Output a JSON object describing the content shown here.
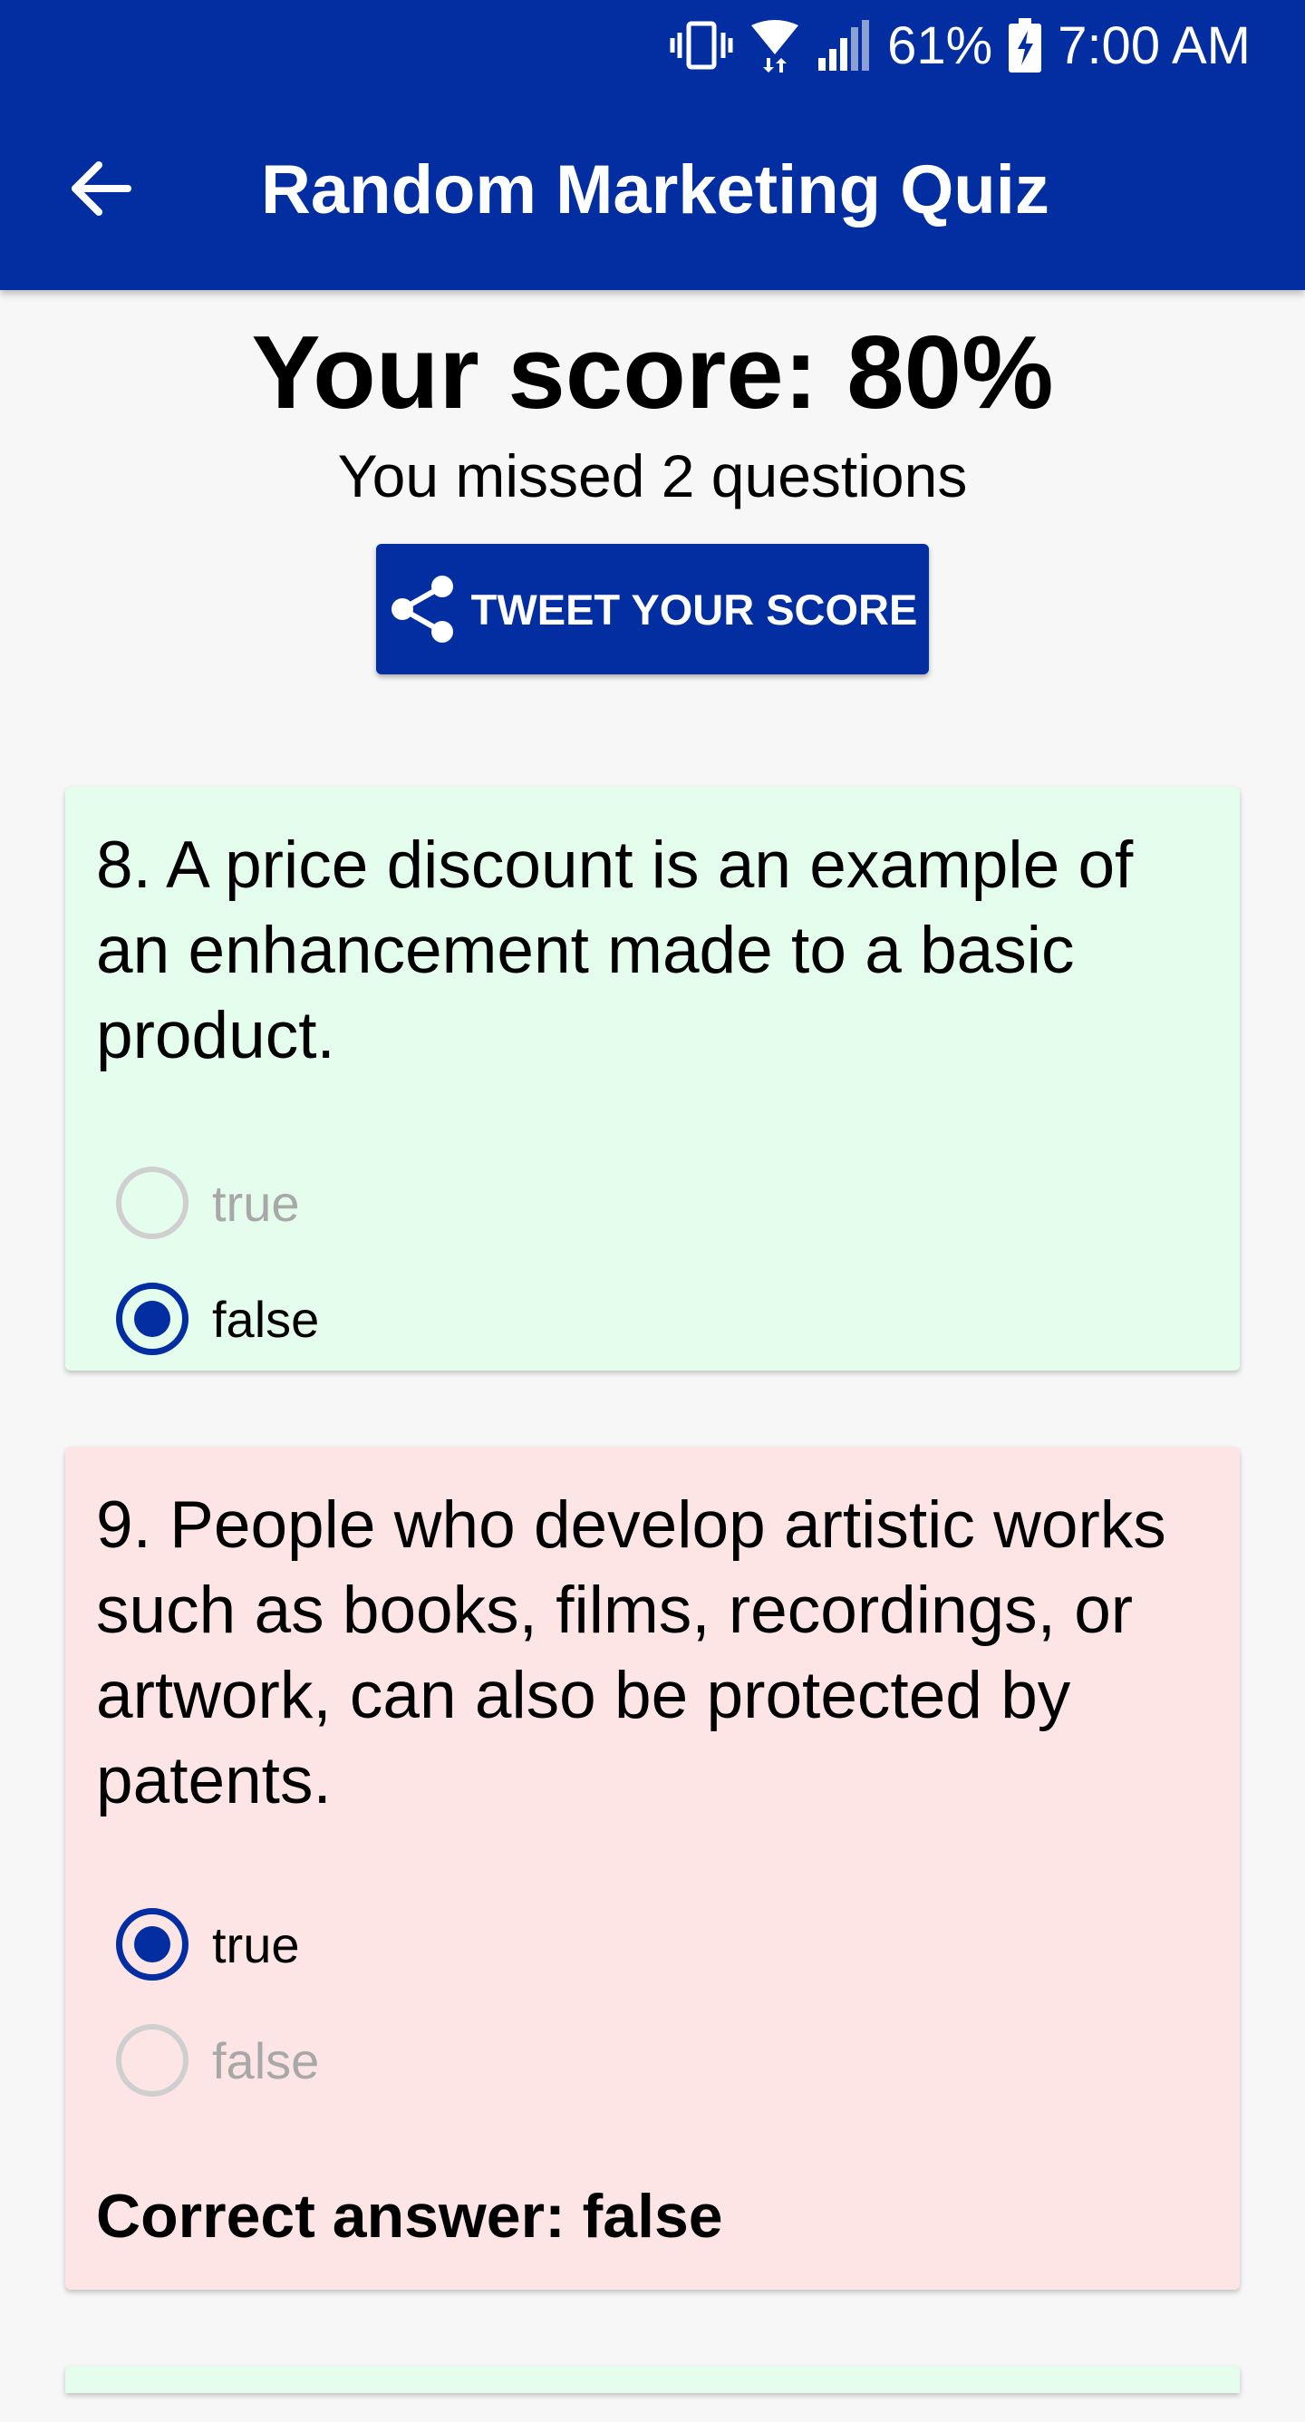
{
  "status_bar": {
    "battery": "61%",
    "time": "7:00 AM"
  },
  "app_bar": {
    "title": "Random Marketing Quiz"
  },
  "results": {
    "score": "Your score: 80%",
    "missed": "You missed 2 questions",
    "tweet_label": "TWEET YOUR SCORE"
  },
  "questions": [
    {
      "text": "8. A price discount is an example of an enhancement made to a basic product.",
      "status": "correct",
      "options": [
        {
          "label": "true",
          "selected": false
        },
        {
          "label": "false",
          "selected": true
        }
      ]
    },
    {
      "text": "9. People who develop artistic works such as books, films, recordings, or artwork, can also be protected by patents.",
      "status": "wrong",
      "options": [
        {
          "label": "true",
          "selected": true
        },
        {
          "label": "false",
          "selected": false
        }
      ],
      "correct_answer": "Correct answer: false"
    }
  ],
  "colors": {
    "primary": "#032ea1",
    "correct_bg": "#e5fdec",
    "wrong_bg": "#fde5e6",
    "background": "#f7f7f7"
  },
  "icons": [
    "vibrate-icon",
    "wifi-icon",
    "signal-icon",
    "battery-charging-icon",
    "back-arrow-icon",
    "share-icon"
  ]
}
